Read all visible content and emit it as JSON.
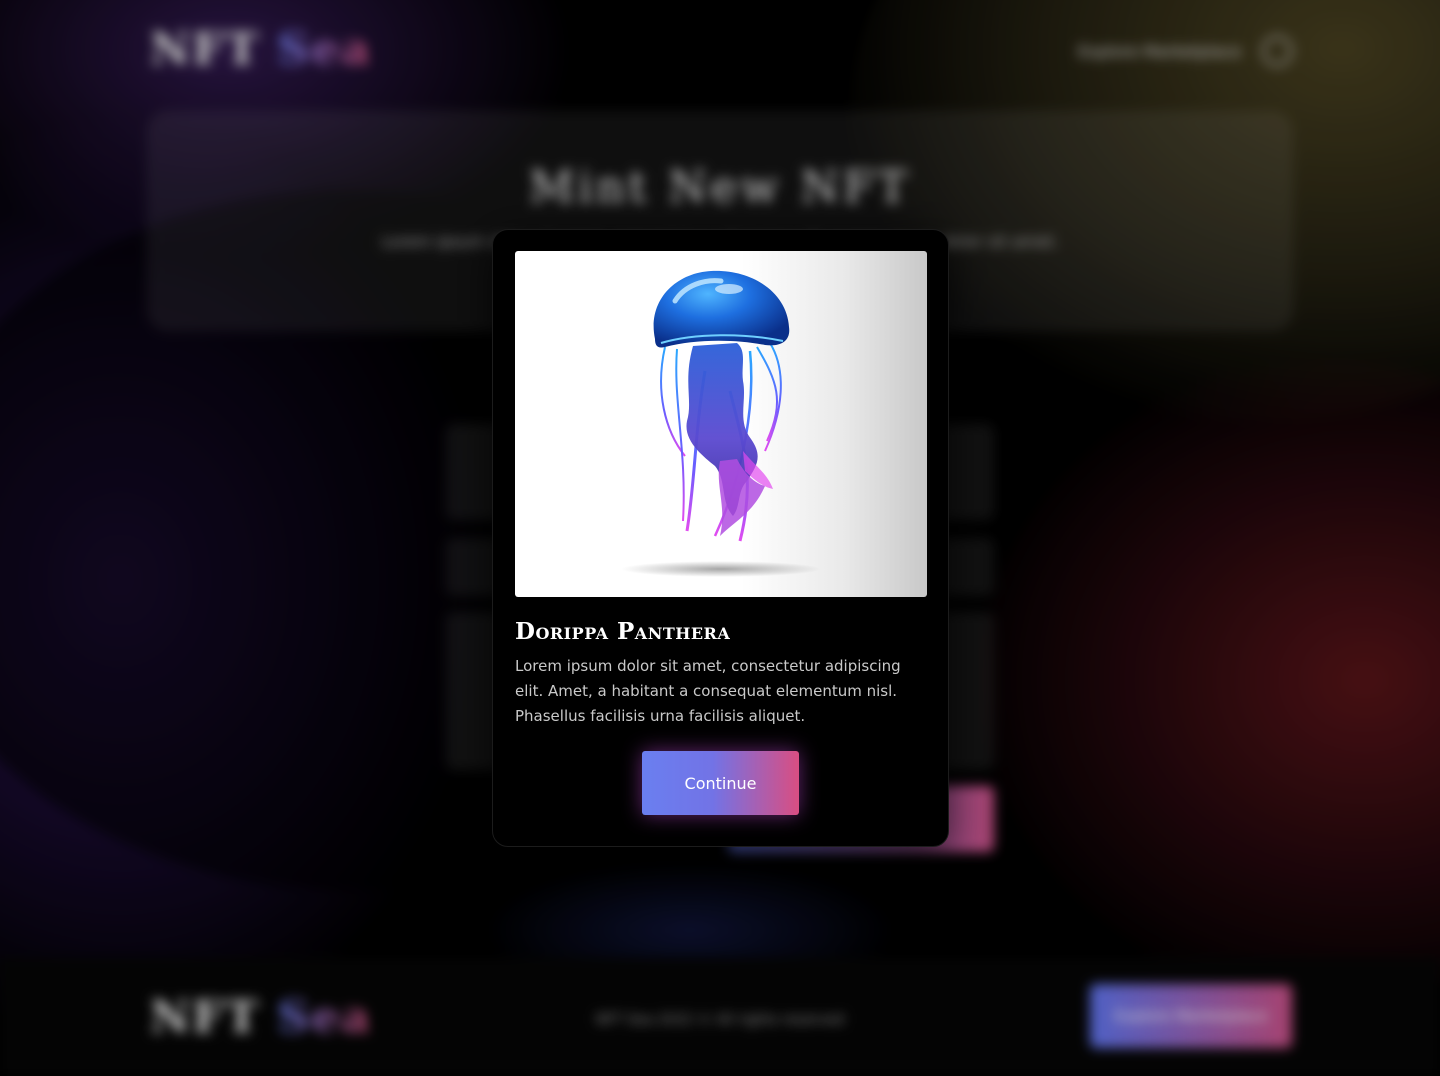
{
  "background": {
    "logo": {
      "part1": "NFT",
      "part2": "Sea"
    },
    "nav": {
      "marketplace_link": "Explore Marketplace",
      "profile_icon": "user-circle-icon"
    },
    "hero": {
      "title": "Mint New NFT",
      "subtitle": "Lorem ipsum dolor sit amet, consectetur adipiscing elit. Lorem ipsum dolor sit amet."
    },
    "footer": {
      "logo": {
        "part1": "NFT",
        "part2": "Sea"
      },
      "copyright": "NFT Sea 2022 © All rights reserved",
      "button_label": "Explore Marketplace"
    }
  },
  "modal": {
    "image_icon": "jellyfish-illustration",
    "title": "Dorippa Panthera",
    "description": "Lorem ipsum dolor sit amet, consectetur adipiscing elit. Amet, a habitant a consequat elementum nisl. Phasellus facilisis urna facilisis aliquet.",
    "continue_label": "Continue"
  },
  "colors": {
    "accent_start": "#6a7ff0",
    "accent_end": "#d94e82",
    "modal_bg": "#000000"
  }
}
